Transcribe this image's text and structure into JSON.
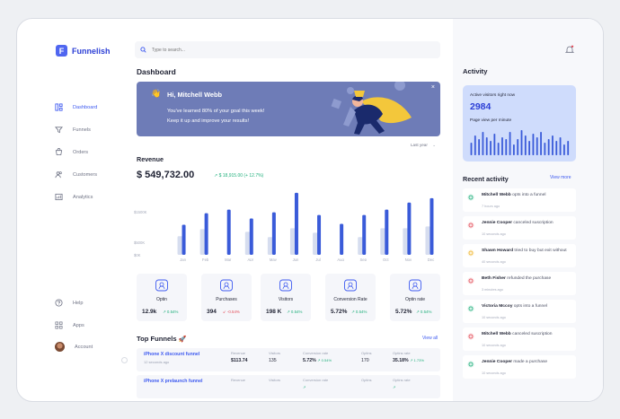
{
  "brand": {
    "name": "Funnelish",
    "logo_letter": "F"
  },
  "sidebar": {
    "items": [
      {
        "label": "Dashboard",
        "icon": "dashboard-icon"
      },
      {
        "label": "Funnels",
        "icon": "funnel-icon"
      },
      {
        "label": "Orders",
        "icon": "orders-icon"
      },
      {
        "label": "Customers",
        "icon": "customers-icon"
      },
      {
        "label": "Analytics",
        "icon": "analytics-icon"
      }
    ],
    "bottom": [
      {
        "label": "Help",
        "icon": "help-icon"
      },
      {
        "label": "Apps",
        "icon": "apps-icon"
      },
      {
        "label": "Account",
        "icon": "avatar"
      }
    ]
  },
  "search": {
    "placeholder": "Type to search..."
  },
  "dashboard": {
    "title": "Dashboard",
    "banner": {
      "greeting": "Hi, Mitchell Webb",
      "line1": "You've learned 80% of your goal this week!",
      "line2": "Keep it up and improve your results!",
      "close": "×"
    },
    "period": "Last year",
    "revenue": {
      "title": "Revenue",
      "amount": "$ 549,732.00",
      "change": "$ 18,915.00 (+ 12.7%)"
    }
  },
  "chart_data": {
    "type": "bar",
    "categories": [
      "Jan",
      "Feb",
      "Mar",
      "Apr",
      "May",
      "Jun",
      "Jul",
      "Aug",
      "Sep",
      "Oct",
      "Nov",
      "Dec"
    ],
    "series": [
      {
        "values": [
          210,
          290,
          0,
          260,
          200,
          300,
          250,
          0,
          200,
          300,
          300,
          320
        ]
      },
      {
        "values": [
          340,
          470,
          510,
          410,
          480,
          700,
          450,
          350,
          450,
          510,
          590,
          640
        ]
      }
    ],
    "ytick_labels": [
      "$1500K",
      "$500K",
      "$0K"
    ],
    "ylim": [
      0,
      750
    ],
    "colors": [
      "#d6ddef",
      "#3a5bd9"
    ]
  },
  "stats": [
    {
      "label": "Optin",
      "value": "12.9k",
      "change": "0.54%",
      "dir": "up",
      "icon": "optin-icon"
    },
    {
      "label": "Purchases",
      "value": "394",
      "change": "-0.54%",
      "dir": "down",
      "icon": "purchase-icon"
    },
    {
      "label": "Visitors",
      "value": "198 K",
      "change": "0.54%",
      "dir": "up",
      "icon": "visitors-icon"
    },
    {
      "label": "Conversion Rate",
      "value": "5.72%",
      "change": "0.54%",
      "dir": "up",
      "icon": "conversion-icon"
    },
    {
      "label": "Optin rate",
      "value": "5.72%",
      "change": "0.54%",
      "dir": "up",
      "icon": "optin-rate-icon"
    }
  ],
  "top_funnels": {
    "title": "Top Funnels",
    "emoji": "🚀",
    "view_all": "View all",
    "columns": [
      "Revenue",
      "Visitors",
      "Conversion rate",
      "Optins",
      "Optins rate"
    ],
    "rows": [
      {
        "name": "iPhone X discount funnel",
        "time": "12 seconds ago",
        "revenue": "$113.74",
        "visitors": "135",
        "conversion": "5.72%",
        "conversion_change": "0.54%",
        "optins": "170",
        "optin_rate": "35.18%",
        "optin_rate_change": "1.73%"
      },
      {
        "name": "iPhone X prelaunch funnel",
        "time": "",
        "revenue": "",
        "visitors": "",
        "conversion": "",
        "conversion_change": "",
        "optins": "",
        "optin_rate": "",
        "optin_rate_change": ""
      }
    ]
  },
  "activity": {
    "title": "Activity",
    "visitors_now_label": "Active visitors right now",
    "visitors_now": "2984",
    "per_minute_label": "Page view per minute",
    "mini_chart": [
      14,
      22,
      18,
      26,
      20,
      16,
      24,
      14,
      20,
      18,
      26,
      12,
      18,
      28,
      22,
      16,
      24,
      20,
      26,
      14,
      18,
      22,
      16,
      20,
      12,
      16
    ],
    "mini_color": "#3a5bd9",
    "recent_title": "Recent activity",
    "view_more": "View more",
    "items": [
      {
        "who": "Mitchell Webb",
        "text": "opts into a funnel",
        "time": "7 hours ago",
        "color": "#22b07d",
        "icon": "funnel-activity-icon"
      },
      {
        "who": "Jennie Cooper",
        "text": "canceled suscription",
        "time": "10 seconds ago",
        "color": "#e34d59",
        "icon": "calendar-icon"
      },
      {
        "who": "Shawn Howard",
        "text": "tried to buy but exit without",
        "time": "40 seconds ago",
        "color": "#f0b429",
        "icon": "cart-icon"
      },
      {
        "who": "Beth Fisher",
        "text": "refunded the purchase",
        "time": "3 minutes ago",
        "color": "#e34d59",
        "icon": "refund-icon"
      },
      {
        "who": "Victoria Mccoy",
        "text": "opts into a funnel",
        "time": "10 seconds ago",
        "color": "#22b07d",
        "icon": "funnel-activity-icon"
      },
      {
        "who": "Mitchell Webb",
        "text": "canceled suscription",
        "time": "10 seconds ago",
        "color": "#e34d59",
        "icon": "calendar-icon"
      },
      {
        "who": "Jennie Cooper",
        "text": "made a purchase",
        "time": "10 seconds ago",
        "color": "#22b07d",
        "icon": "purchase-activity-icon"
      }
    ]
  }
}
